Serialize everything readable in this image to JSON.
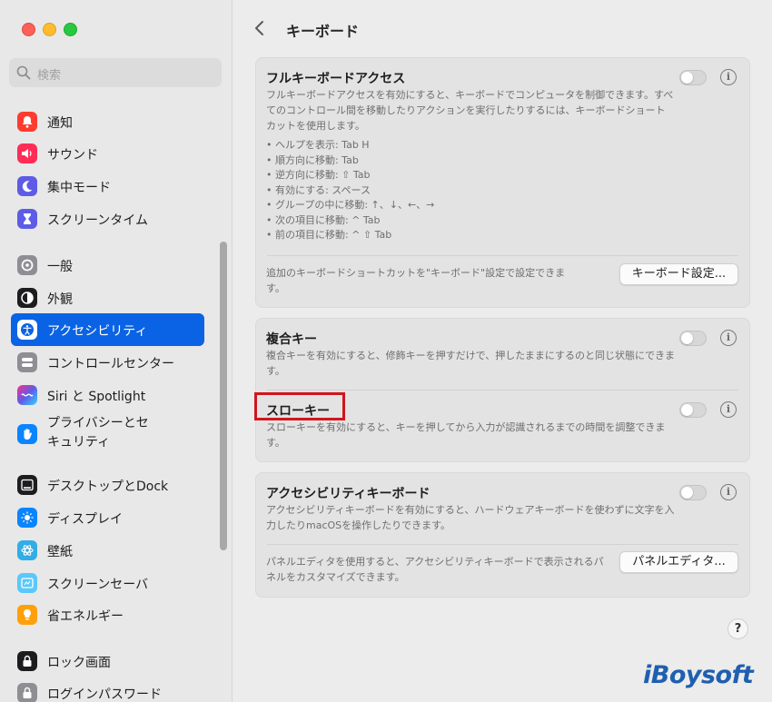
{
  "window": {
    "title": "キーボード"
  },
  "sidebar": {
    "search_placeholder": "検索",
    "items": [
      {
        "label": "通知",
        "icon": "bell-icon",
        "color": "#ff3b30"
      },
      {
        "label": "サウンド",
        "icon": "speaker-icon",
        "color": "#ff2d55"
      },
      {
        "label": "集中モード",
        "icon": "moon-icon",
        "color": "#5e5ce6"
      },
      {
        "label": "スクリーンタイム",
        "icon": "hourglass-icon",
        "color": "#5e5ce6"
      },
      {
        "label": "一般",
        "icon": "gear-icon",
        "color": "#8e8e93"
      },
      {
        "label": "外観",
        "icon": "appearance-icon",
        "color": "#1d1d1f"
      },
      {
        "label": "アクセシビリティ",
        "icon": "accessibility-icon",
        "color": "#0a63e4",
        "selected": true
      },
      {
        "label": "コントロールセンター",
        "icon": "control-center-icon",
        "color": "#8e8e93"
      },
      {
        "label": "Siri と Spotlight",
        "icon": "siri-icon",
        "color": "#1d1d1f"
      },
      {
        "label": "プライバシーとセキュリティ",
        "icon": "hand-icon",
        "color": "#0a84ff"
      },
      {
        "label": "デスクトップとDock",
        "icon": "dock-icon",
        "color": "#1d1d1f"
      },
      {
        "label": "ディスプレイ",
        "icon": "sun-icon",
        "color": "#0a84ff"
      },
      {
        "label": "壁紙",
        "icon": "flower-icon",
        "color": "#32ade6"
      },
      {
        "label": "スクリーンセーバ",
        "icon": "screensaver-icon",
        "color": "#5ac8fa"
      },
      {
        "label": "省エネルギー",
        "icon": "bulb-icon",
        "color": "#ff9f0a"
      },
      {
        "label": "ロック画面",
        "icon": "lock-icon",
        "color": "#1d1d1f"
      },
      {
        "label": "ログインパスワード",
        "icon": "password-icon",
        "color": "#8e8e93"
      }
    ]
  },
  "full_keyboard": {
    "title": "フルキーボードアクセス",
    "desc": "フルキーボードアクセスを有効にすると、キーボードでコンピュータを制御できます。すべてのコントロール間を移動したりアクションを実行したりするには、キーボードショートカットを使用します。",
    "bullets": [
      "• ヘルプを表示: Tab H",
      "• 順方向に移動: Tab",
      "• 逆方向に移動: ⇧ Tab",
      "• 有効にする: スペース",
      "• グループの中に移動: ↑、↓、←、→",
      "• 次の項目に移動: ^ Tab",
      "• 前の項目に移動: ^ ⇧ Tab"
    ],
    "footer": "追加のキーボードショートカットを\"キーボード\"設定で設定できます。",
    "button": "キーボード設定..."
  },
  "sticky_keys": {
    "title": "複合キー",
    "desc": "複合キーを有効にすると、修飾キーを押すだけで、押したままにするのと同じ状態にできます。"
  },
  "slow_keys": {
    "title": "スローキー",
    "desc": "スローキーを有効にすると、キーを押してから入力が認識されるまでの時間を調整できます。"
  },
  "accessibility_keyboard": {
    "title": "アクセシビリティキーボード",
    "desc": "アクセシビリティキーボードを有効にすると、ハードウェアキーボードを使わずに文字を入力したりmacOSを操作したりできます。",
    "footer": "パネルエディタを使用すると、アクセシビリティキーボードで表示されるパネルをカスタマイズできます。",
    "button": "パネルエディタ..."
  },
  "help_label": "?",
  "watermark": "iBoysoft"
}
